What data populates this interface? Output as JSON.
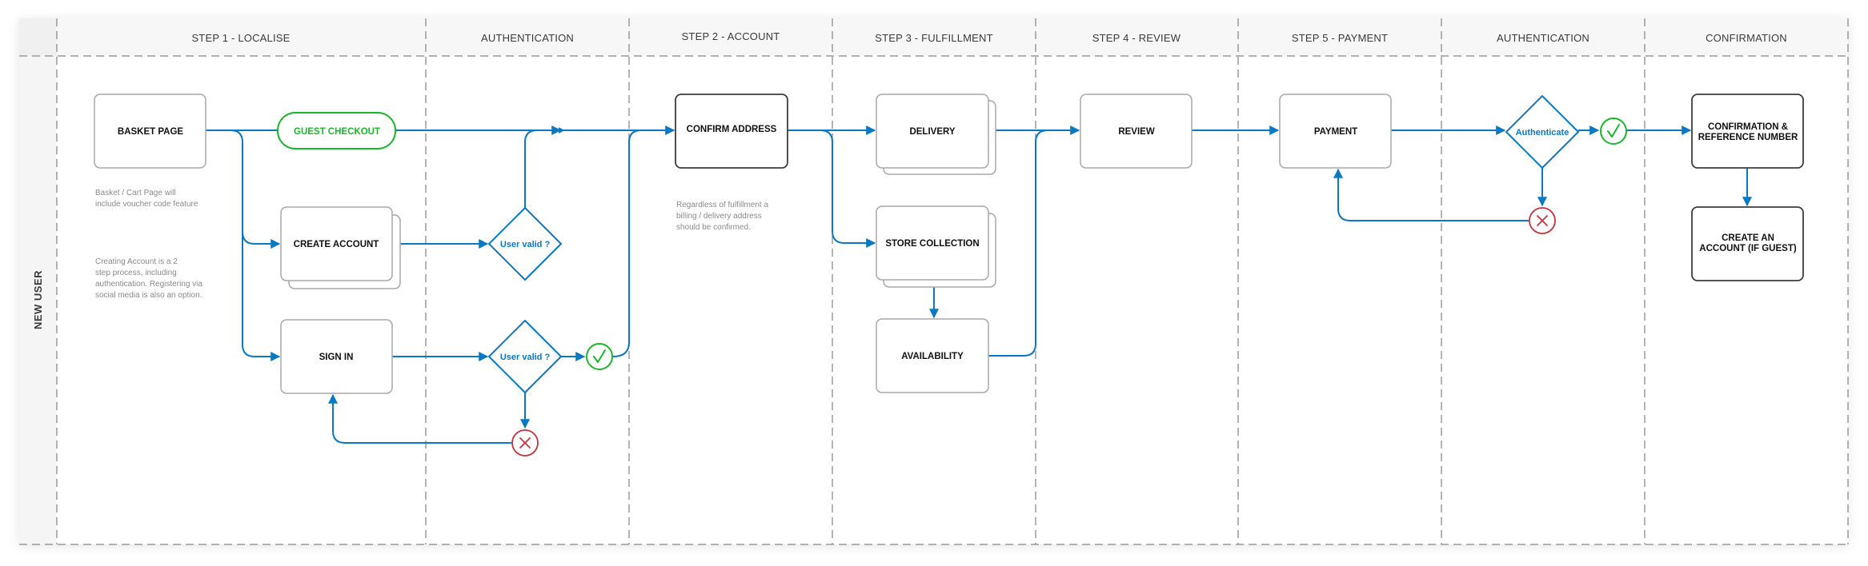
{
  "colors": {
    "flow": "#0a78c2",
    "success": "#19b82b",
    "failure": "#c8323c",
    "node_border": "#a8a8a8",
    "node_border_dark": "#3c3c3c",
    "divider": "#9a9a9a",
    "header_bg": "#f7f7f7",
    "corner_bg": "#f0f0f0"
  },
  "swimlane": {
    "row_label": "NEW USER",
    "columns": [
      {
        "id": "step1",
        "label": "STEP 1 - LOCALISE"
      },
      {
        "id": "auth1",
        "label": "AUTHENTICATION"
      },
      {
        "id": "step2",
        "label": "STEP 2 - ACCOUNT"
      },
      {
        "id": "step3",
        "label": "STEP 3 - FULFILLMENT"
      },
      {
        "id": "step4",
        "label": "STEP 4 - REVIEW"
      },
      {
        "id": "step5",
        "label": "STEP 5 - PAYMENT"
      },
      {
        "id": "auth2",
        "label": "AUTHENTICATION"
      },
      {
        "id": "confirm",
        "label": "CONFIRMATION"
      }
    ]
  },
  "nodes": {
    "basket_page": {
      "label": [
        "BASKET PAGE"
      ],
      "type": "process"
    },
    "guest_checkout": {
      "label": [
        "GUEST CHECKOUT"
      ],
      "type": "terminal-success"
    },
    "create_account": {
      "label": [
        "CREATE ACCOUNT"
      ],
      "type": "multi-page"
    },
    "sign_in": {
      "label": [
        "SIGN IN"
      ],
      "type": "process"
    },
    "user_valid_1": {
      "label": [
        "User valid ?"
      ],
      "type": "decision"
    },
    "user_valid_2": {
      "label": [
        "User valid ?"
      ],
      "type": "decision"
    },
    "confirm_address": {
      "label": [
        "CONFIRM ADDRESS"
      ],
      "type": "process-key"
    },
    "delivery": {
      "label": [
        "DELIVERY"
      ],
      "type": "multi-page"
    },
    "store_collection": {
      "label": [
        "STORE COLLECTION"
      ],
      "type": "multi-page"
    },
    "availability": {
      "label": [
        "AVAILABILITY"
      ],
      "type": "process"
    },
    "review": {
      "label": [
        "REVIEW"
      ],
      "type": "process"
    },
    "payment": {
      "label": [
        "PAYMENT"
      ],
      "type": "process"
    },
    "authenticate": {
      "label": [
        "Authenticate"
      ],
      "type": "decision"
    },
    "confirmation": {
      "label": [
        "CONFIRMATION &",
        "REFERENCE NUMBER"
      ],
      "type": "process-key"
    },
    "create_an_account": {
      "label": [
        "CREATE AN",
        "ACCOUNT (IF GUEST)"
      ],
      "type": "process-key"
    }
  },
  "status_icons": {
    "success": "check-circle-icon",
    "failure": "x-circle-icon"
  },
  "notes": {
    "basket": [
      "Basket / Cart Page will",
      "include voucher code feature"
    ],
    "create_account": [
      "Creating Account is a 2",
      "step process, including",
      "authentication. Registering via",
      "social media is also an option."
    ],
    "confirm_address": [
      "Regardless of fulfillment a",
      "billing / delivery address",
      "should be confirmed."
    ]
  },
  "edges": [
    {
      "from": "basket_page",
      "to": "guest_checkout"
    },
    {
      "from": "guest_checkout",
      "to": "confirm_address"
    },
    {
      "from": "basket_page",
      "to": "create_account"
    },
    {
      "from": "basket_page",
      "to": "sign_in"
    },
    {
      "from": "create_account",
      "to": "user_valid_1"
    },
    {
      "from": "user_valid_1",
      "to": "confirm_address",
      "outcome": "valid"
    },
    {
      "from": "sign_in",
      "to": "user_valid_2"
    },
    {
      "from": "user_valid_2",
      "to": "confirm_address",
      "outcome": "valid"
    },
    {
      "from": "user_valid_2",
      "to": "sign_in",
      "outcome": "invalid"
    },
    {
      "from": "confirm_address",
      "to": "delivery"
    },
    {
      "from": "confirm_address",
      "to": "store_collection"
    },
    {
      "from": "store_collection",
      "to": "availability"
    },
    {
      "from": "delivery",
      "to": "review"
    },
    {
      "from": "availability",
      "to": "review"
    },
    {
      "from": "review",
      "to": "payment"
    },
    {
      "from": "payment",
      "to": "authenticate"
    },
    {
      "from": "authenticate",
      "to": "confirmation",
      "outcome": "valid"
    },
    {
      "from": "authenticate",
      "to": "payment",
      "outcome": "invalid"
    },
    {
      "from": "confirmation",
      "to": "create_an_account"
    }
  ]
}
